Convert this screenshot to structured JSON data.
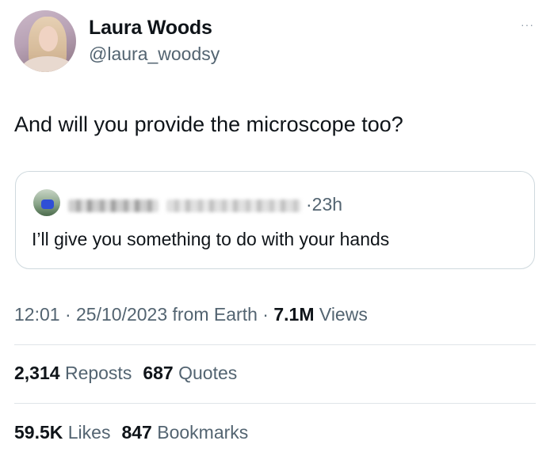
{
  "author": {
    "display_name": "Laura Woods",
    "handle": "@laura_woodsy"
  },
  "more_icon": "···",
  "tweet": {
    "text": "And will you provide the microscope too?"
  },
  "quoted": {
    "time_sep": "·",
    "time": "23h",
    "text": "I’ll give you something to do with your hands"
  },
  "meta": {
    "time": "12:01",
    "sep1": " · ",
    "date": "25/10/2023",
    "source": " from Earth",
    "sep2": " · ",
    "views_count": "7.1M",
    "views_label": " Views"
  },
  "stats": {
    "reposts_count": "2,314",
    "reposts_label": " Reposts",
    "quotes_count": "687",
    "quotes_label": " Quotes",
    "likes_count": "59.5K",
    "likes_label": " Likes",
    "bookmarks_count": "847",
    "bookmarks_label": " Bookmarks"
  },
  "icons": {
    "more": "more-horizontal-icon"
  }
}
